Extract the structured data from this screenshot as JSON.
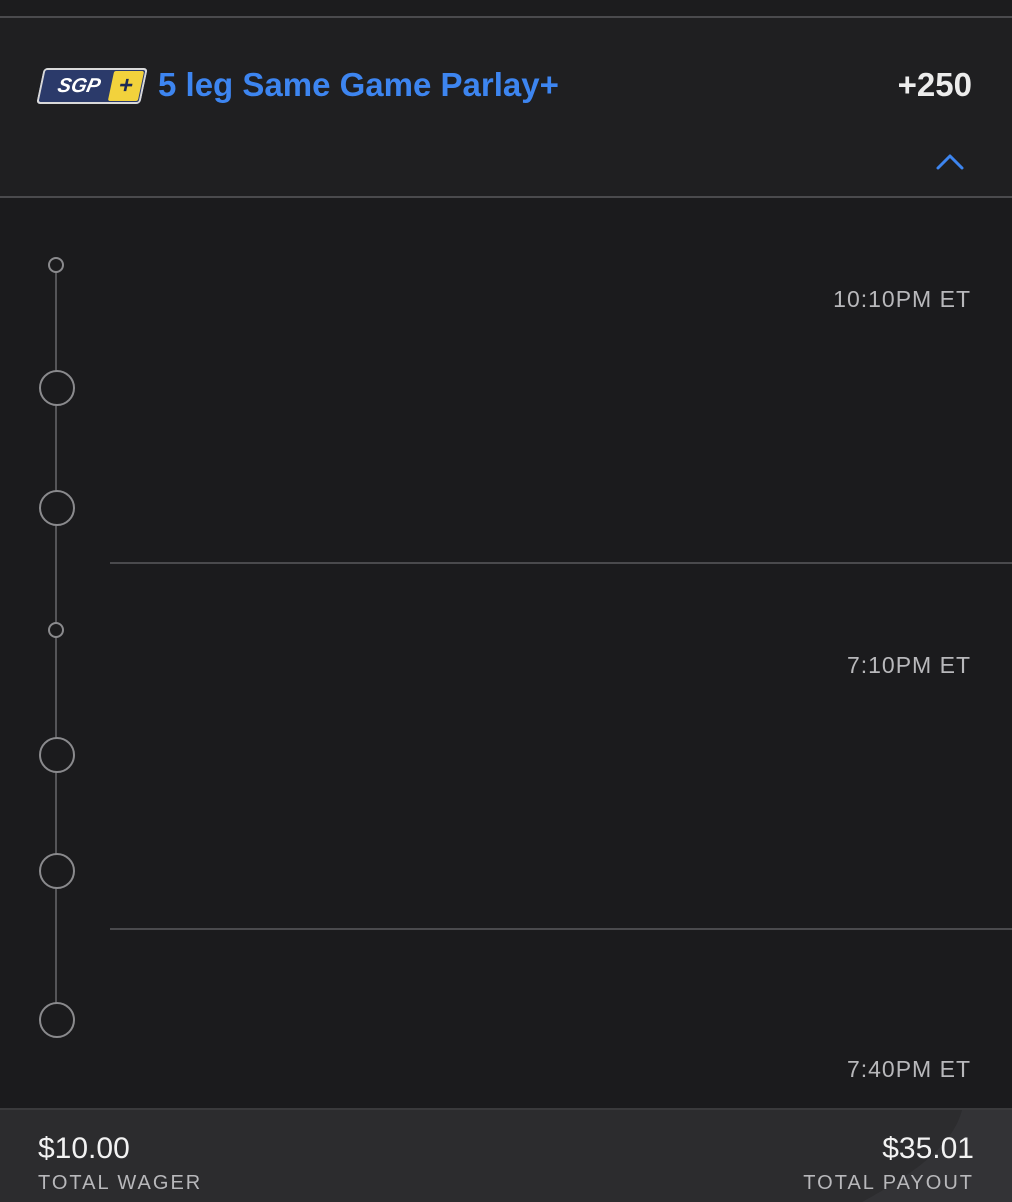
{
  "header": {
    "badge_text": "SGP",
    "badge_plus": "+",
    "title": "5 leg Same Game Parlay+",
    "odds": "+250",
    "collapse_icon": "chevron-up-icon",
    "accent_color": "#3d85f0",
    "badge_accent_color": "#f2d23c"
  },
  "legs": [
    {
      "time": "10:10PM ET"
    },
    {
      "time": "7:10PM ET"
    },
    {
      "time": "7:40PM ET"
    }
  ],
  "footer": {
    "wager_amount": "$10.00",
    "wager_label": "TOTAL WAGER",
    "payout_amount": "$35.01",
    "payout_label": "TOTAL PAYOUT"
  }
}
